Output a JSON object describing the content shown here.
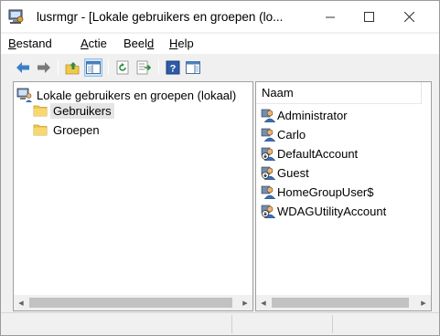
{
  "window": {
    "title": "lusrmgr - [Lokale gebruikers en groepen (lo...",
    "minimize_glyph": "—",
    "maximize_glyph": "☐",
    "close_glyph": "✕"
  },
  "menu": {
    "items": [
      {
        "label": "Bestand",
        "underline": "B",
        "rest": "estand"
      },
      {
        "label": "Actie",
        "underline": "A",
        "rest": "ctie"
      },
      {
        "label": "Beeld",
        "prefix": "Beel",
        "underline": "d",
        "rest": ""
      },
      {
        "label": "Help",
        "underline": "H",
        "rest": "elp"
      }
    ]
  },
  "toolbar": {
    "icons": [
      "back-arrow-icon",
      "forward-arrow-icon",
      "up-folder-icon",
      "show-hide-console-tree-icon",
      "refresh-icon",
      "export-list-icon",
      "help-icon",
      "properties-pane-icon"
    ],
    "help_glyph": "?"
  },
  "tree": {
    "root": "Lokale gebruikers en groepen (lokaal)",
    "children": [
      "Gebruikers",
      "Groepen"
    ],
    "selected": "Gebruikers"
  },
  "list": {
    "column_header": "Naam",
    "users": [
      "Administrator",
      "Carlo",
      "DefaultAccount",
      "Guest",
      "HomeGroupUser$",
      "WDAGUtilityAccount"
    ],
    "disabled_users": [
      "DefaultAccount",
      "Guest",
      "WDAGUtilityAccount"
    ]
  },
  "scroll": {
    "left_arrow": "◀",
    "right_arrow": "▶"
  },
  "colors": {
    "accent_blue": "#3c7fc7",
    "folder_yellow": "#f0c94a",
    "selection_gray": "#e5e5e5"
  }
}
